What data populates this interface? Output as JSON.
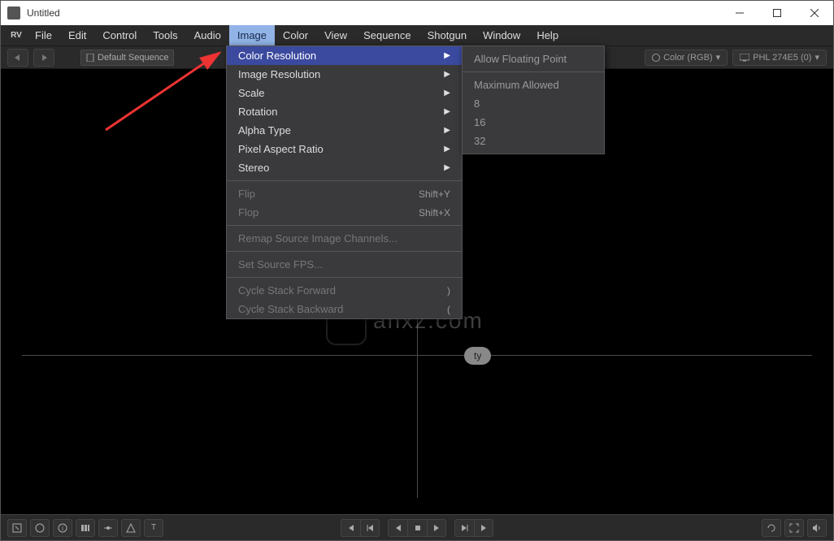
{
  "window": {
    "title": "Untitled",
    "logo": "RV"
  },
  "menubar": [
    "File",
    "Edit",
    "Control",
    "Tools",
    "Audio",
    "Image",
    "Color",
    "View",
    "Sequence",
    "Shotgun",
    "Window",
    "Help"
  ],
  "menubar_active": "Image",
  "toolbar": {
    "sequence_label": "Default Sequence",
    "color_label": "Color (RGB)",
    "display_label": "PHL 274E5 (0)"
  },
  "dropdown": {
    "items": [
      {
        "label": "Color Resolution",
        "type": "submenu",
        "selected": true
      },
      {
        "label": "Image Resolution",
        "type": "submenu"
      },
      {
        "label": "Scale",
        "type": "submenu"
      },
      {
        "label": "Rotation",
        "type": "submenu"
      },
      {
        "label": "Alpha Type",
        "type": "submenu"
      },
      {
        "label": "Pixel Aspect Ratio",
        "type": "submenu"
      },
      {
        "label": "Stereo",
        "type": "submenu"
      },
      {
        "type": "sep"
      },
      {
        "label": "Flip",
        "shortcut": "Shift+Y",
        "disabled": true
      },
      {
        "label": "Flop",
        "shortcut": "Shift+X",
        "disabled": true
      },
      {
        "type": "sep"
      },
      {
        "label": "Remap Source Image Channels...",
        "disabled": true
      },
      {
        "type": "sep"
      },
      {
        "label": "Set Source FPS...",
        "disabled": true
      },
      {
        "type": "sep"
      },
      {
        "label": "Cycle Stack Forward",
        "shortcut": ")",
        "disabled": true
      },
      {
        "label": "Cycle Stack Backward",
        "shortcut": "(",
        "disabled": true
      }
    ]
  },
  "submenu": {
    "items": [
      "Allow Floating Point",
      "Maximum Allowed",
      "8",
      "16",
      "32"
    ]
  },
  "viewport": {
    "badge": "ty",
    "watermark": "anxz.com"
  },
  "colors": {
    "accent": "#3b4a9e",
    "menu_active": "#91b3e6"
  }
}
